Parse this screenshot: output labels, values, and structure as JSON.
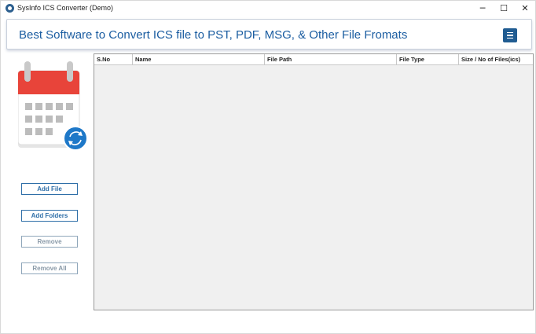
{
  "window": {
    "title": "SysInfo ICS Converter (Demo)",
    "minimize_glyph": "─",
    "maximize_glyph": "☐",
    "close_glyph": "✕"
  },
  "banner": {
    "title": "Best Software to Convert ICS file to PST, PDF, MSG, & Other File Fromats",
    "menu_icon": "hamburger-menu-icon"
  },
  "sidebar": {
    "logo_icon": "calendar-sync-icon",
    "buttons": [
      {
        "label": "Add File",
        "enabled": true
      },
      {
        "label": "Add Folders",
        "enabled": true
      },
      {
        "label": "Remove",
        "enabled": false
      },
      {
        "label": "Remove All",
        "enabled": false
      }
    ]
  },
  "table": {
    "columns": [
      "S.No",
      "Name",
      "File Path",
      "File Type",
      "Size / No of Files(ics)"
    ],
    "rows": []
  },
  "colors": {
    "accent": "#1b5da1",
    "menu_button": "#205c92",
    "calendar_header": "#e8443a",
    "sync_badge": "#1e78c8"
  }
}
